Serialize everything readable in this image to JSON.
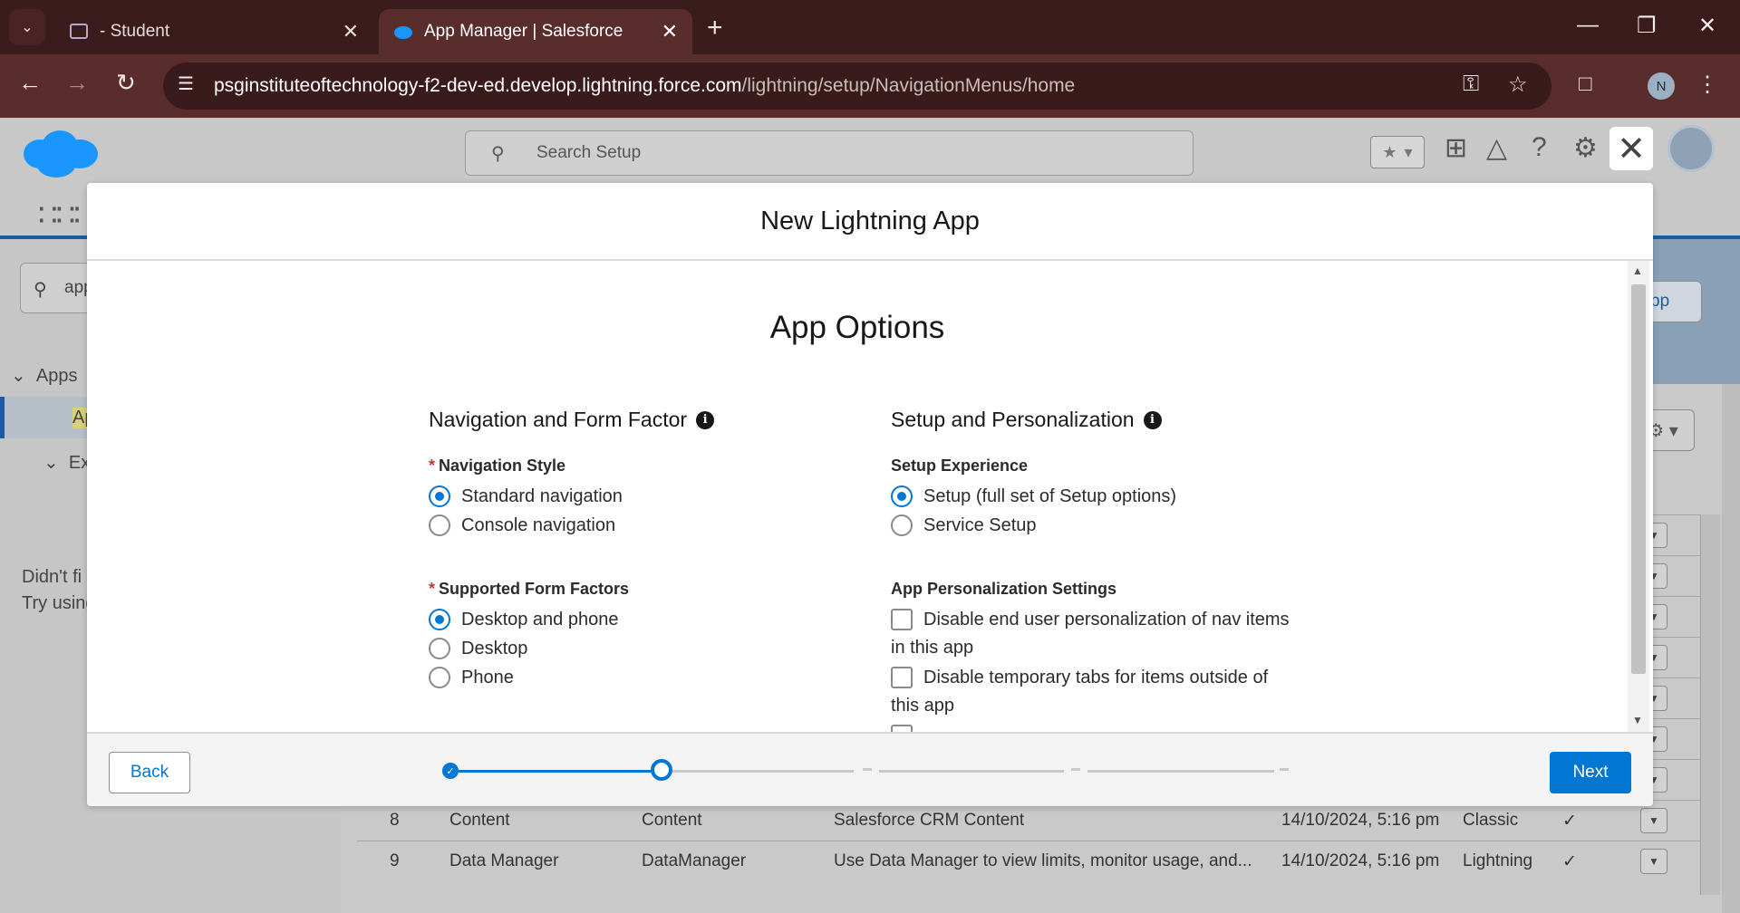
{
  "browser": {
    "tabs": [
      {
        "title": "- Student",
        "active": false
      },
      {
        "title": "App Manager | Salesforce",
        "active": true
      }
    ],
    "url_host": "psginstituteoftechnology-f2-dev-ed.develop.lightning.force.com",
    "url_path": "/lightning/setup/NavigationMenus/home",
    "profile_initial": "N"
  },
  "sf_header": {
    "search_placeholder": "Search Setup"
  },
  "left_nav": {
    "quick_find_value": "app",
    "apps_label": "Apps",
    "selected_item": "Ap",
    "sub_item": "Ex",
    "help_line1": "Didn't fi",
    "help_line2": "Try using"
  },
  "background": {
    "new_app_button": "pp",
    "rows": [
      {
        "num": "8",
        "app_name": "Content",
        "developer_name": "Content",
        "description": "Salesforce CRM Content",
        "modified": "14/10/2024, 5:16 pm",
        "type": "Classic"
      },
      {
        "num": "9",
        "app_name": "Data Manager",
        "developer_name": "DataManager",
        "description": "Use Data Manager to view limits, monitor usage, and...",
        "modified": "14/10/2024, 5:16 pm",
        "type": "Lightning"
      }
    ]
  },
  "modal": {
    "title": "New Lightning App",
    "section_title": "App Options",
    "left": {
      "heading": "Navigation and Form Factor",
      "nav_style_label": "Navigation Style",
      "nav_options": [
        "Standard navigation",
        "Console navigation"
      ],
      "nav_selected": 0,
      "form_factor_label": "Supported Form Factors",
      "form_options": [
        "Desktop and phone",
        "Desktop",
        "Phone"
      ],
      "form_selected": 0
    },
    "right": {
      "heading": "Setup and Personalization",
      "setup_label": "Setup Experience",
      "setup_options": [
        "Setup (full set of Setup options)",
        "Service Setup"
      ],
      "setup_selected": 0,
      "personalization_label": "App Personalization Settings",
      "checkbox1_line1": "Disable end user personalization of nav items",
      "checkbox1_line2": "in this app",
      "checkbox2_line1": "Disable temporary tabs for items outside of",
      "checkbox2_line2": "this app"
    },
    "footer": {
      "back_label": "Back",
      "next_label": "Next",
      "progress_step": 2
    }
  },
  "colors": {
    "brand_blue": "#0176d3",
    "browser_dark": "#3b1c1c",
    "browser_toolbar": "#5a2d2d"
  }
}
